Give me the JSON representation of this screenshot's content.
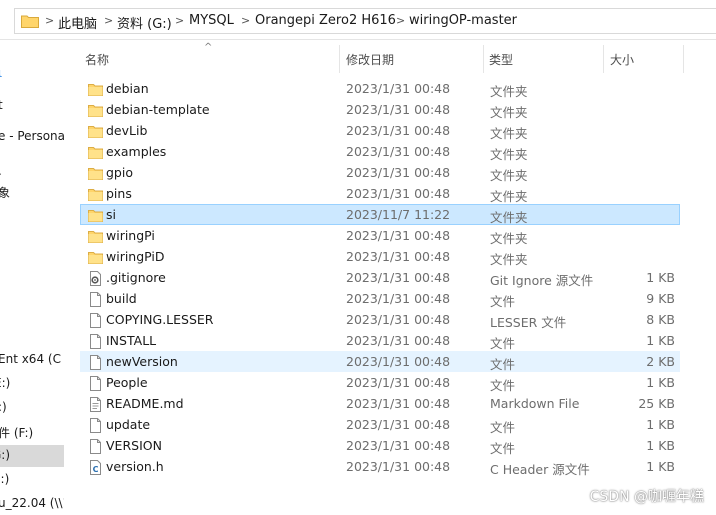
{
  "breadcrumb": [
    "此电脑",
    "资料 (G:)",
    "MYSQL",
    "Orangepi Zero2 H616",
    "wiringOP-master"
  ],
  "nav": {
    "items": [
      {
        "label": "个"
      },
      {
        "label": "ι"
      },
      {
        "label": "t"
      },
      {
        "label": "e - Persona"
      },
      {
        "label": "."
      },
      {
        "label": "象"
      },
      {
        "label": "Ent x64 (C"
      },
      {
        "label": "E:)"
      },
      {
        "label": ":)"
      },
      {
        "label": "件 (F:)"
      },
      {
        "label": "G:)"
      },
      {
        "label": "I:)"
      },
      {
        "label": "u_22.04 (\\\\1"
      }
    ]
  },
  "columns": {
    "name": "名称",
    "date": "修改日期",
    "type": "类型",
    "size": "大小"
  },
  "files": [
    {
      "name": "debian",
      "date": "2023/1/31 00:48",
      "type": "文件夹",
      "size": "",
      "icon": "folder-icon"
    },
    {
      "name": "debian-template",
      "date": "2023/1/31 00:48",
      "type": "文件夹",
      "size": "",
      "icon": "folder-icon"
    },
    {
      "name": "devLib",
      "date": "2023/1/31 00:48",
      "type": "文件夹",
      "size": "",
      "icon": "folder-icon"
    },
    {
      "name": "examples",
      "date": "2023/1/31 00:48",
      "type": "文件夹",
      "size": "",
      "icon": "folder-icon"
    },
    {
      "name": "gpio",
      "date": "2023/1/31 00:48",
      "type": "文件夹",
      "size": "",
      "icon": "folder-icon"
    },
    {
      "name": "pins",
      "date": "2023/1/31 00:48",
      "type": "文件夹",
      "size": "",
      "icon": "folder-icon"
    },
    {
      "name": "si",
      "date": "2023/11/7 11:22",
      "type": "文件夹",
      "size": "",
      "icon": "folder-icon"
    },
    {
      "name": "wiringPi",
      "date": "2023/1/31 00:48",
      "type": "文件夹",
      "size": "",
      "icon": "folder-icon"
    },
    {
      "name": "wiringPiD",
      "date": "2023/1/31 00:48",
      "type": "文件夹",
      "size": "",
      "icon": "folder-icon"
    },
    {
      "name": ".gitignore",
      "date": "2023/1/31 00:48",
      "type": "Git Ignore 源文件",
      "size": "1 KB",
      "icon": "gear-file-icon"
    },
    {
      "name": "build",
      "date": "2023/1/31 00:48",
      "type": "文件",
      "size": "9 KB",
      "icon": "file-icon"
    },
    {
      "name": "COPYING.LESSER",
      "date": "2023/1/31 00:48",
      "type": "LESSER 文件",
      "size": "8 KB",
      "icon": "file-icon"
    },
    {
      "name": "INSTALL",
      "date": "2023/1/31 00:48",
      "type": "文件",
      "size": "1 KB",
      "icon": "file-icon"
    },
    {
      "name": "newVersion",
      "date": "2023/1/31 00:48",
      "type": "文件",
      "size": "2 KB",
      "icon": "file-icon"
    },
    {
      "name": "People",
      "date": "2023/1/31 00:48",
      "type": "文件",
      "size": "1 KB",
      "icon": "file-icon"
    },
    {
      "name": "README.md",
      "date": "2023/1/31 00:48",
      "type": "Markdown File",
      "size": "25 KB",
      "icon": "text-file-icon"
    },
    {
      "name": "update",
      "date": "2023/1/31 00:48",
      "type": "文件",
      "size": "1 KB",
      "icon": "file-icon"
    },
    {
      "name": "VERSION",
      "date": "2023/1/31 00:48",
      "type": "文件",
      "size": "1 KB",
      "icon": "file-icon"
    },
    {
      "name": "version.h",
      "date": "2023/1/31 00:48",
      "type": "C Header 源文件",
      "size": "1 KB",
      "icon": "c-file-icon"
    }
  ],
  "watermark": "CSDN @咖喱年糕"
}
